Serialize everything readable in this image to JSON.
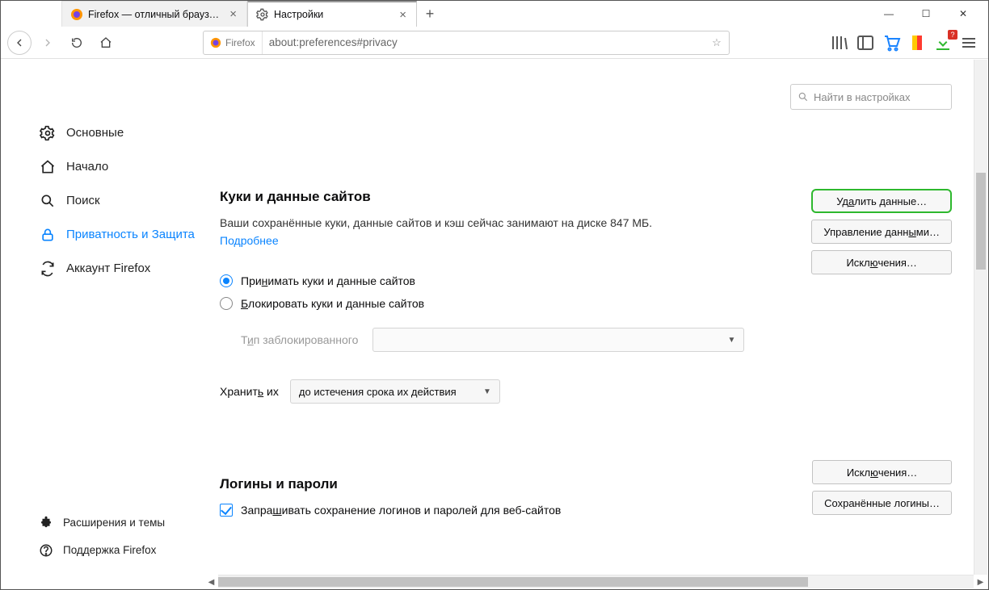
{
  "tabs": {
    "inactive": {
      "label": "Firefox — отличный браузер д"
    },
    "active": {
      "label": "Настройки"
    }
  },
  "urlbar": {
    "identity": "Firefox",
    "url": "about:preferences#privacy"
  },
  "search": {
    "placeholder": "Найти в настройках"
  },
  "sidebar": {
    "general": "Основные",
    "home": "Начало",
    "search": "Поиск",
    "privacy": "Приватность и Защита",
    "sync": "Аккаунт Firefox",
    "ext": "Расширения и темы",
    "support": "Поддержка Firefox"
  },
  "cookies": {
    "heading": "Куки и данные сайтов",
    "desc": "Ваши сохранённые куки, данные сайтов и кэш сейчас занимают на диске 847 МБ.",
    "more": "Подробнее",
    "accept_pre": "При",
    "accept_u": "н",
    "accept_post": "имать куки и данные сайтов",
    "block_pre": "",
    "block_u": "Б",
    "block_post": "локировать куки и данные сайтов",
    "type_label_pre": "Т",
    "type_label_u": "и",
    "type_label_post": "п заблокированного",
    "keep_pre": "Хранит",
    "keep_u": "ь",
    "keep_post": " их",
    "keep_sel": "до истечения срока их действия",
    "btn_clear_pre": "Уд",
    "btn_clear_u": "а",
    "btn_clear_post": "лить данные…",
    "btn_manage_pre": "Управление данн",
    "btn_manage_u": "ы",
    "btn_manage_post": "ми…",
    "btn_exc_pre": "Искл",
    "btn_exc_u": "ю",
    "btn_exc_post": "чения…"
  },
  "logins": {
    "heading": "Логины и пароли",
    "ask_pre": "Запра",
    "ask_u": "ш",
    "ask_post": "ивать сохранение логинов и паролей для веб-сайтов",
    "btn_exc_pre": "Искл",
    "btn_exc_u": "ю",
    "btn_exc_post": "чения…",
    "btn_saved": "Сохранённые логины…"
  }
}
